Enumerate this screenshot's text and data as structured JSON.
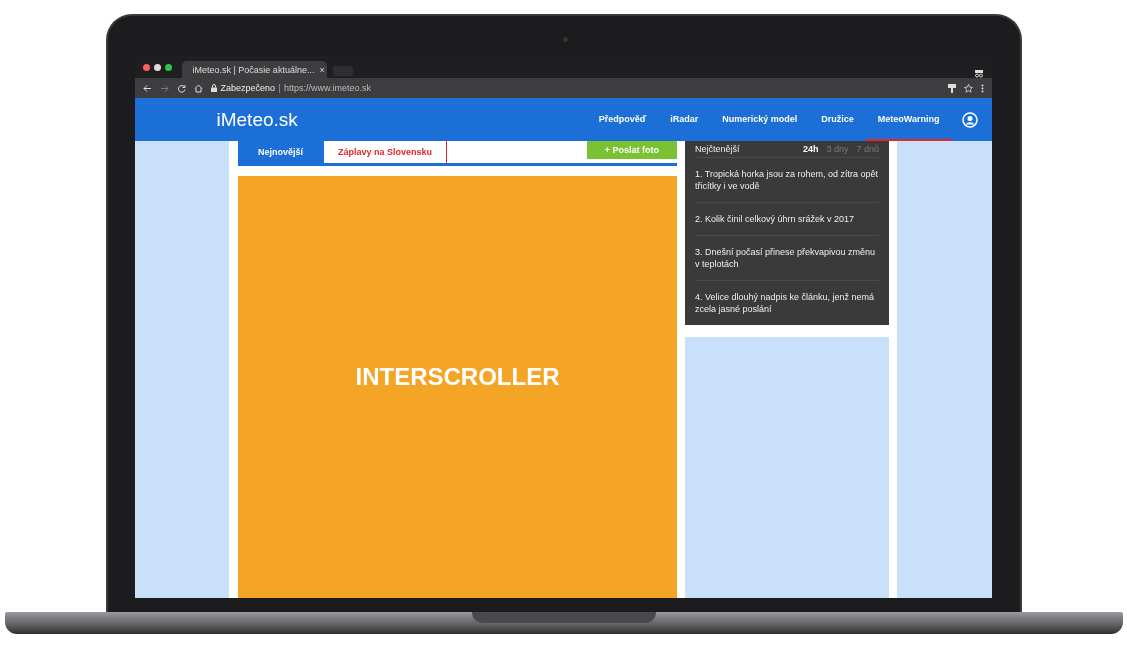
{
  "browser": {
    "tab_title": "iMeteo.sk | Počasie aktuálne...",
    "close": "×",
    "security": "Zabezpečeno",
    "url": "https://www.imeteo.sk"
  },
  "header": {
    "logo": "iMeteo.sk",
    "nav": [
      {
        "label": "Předpověď",
        "selected": false
      },
      {
        "label": "iRadar",
        "selected": false
      },
      {
        "label": "Numerický model",
        "selected": false
      },
      {
        "label": "Družice",
        "selected": false
      },
      {
        "label": "MeteoWarning",
        "selected": true
      }
    ]
  },
  "news_tabs": [
    {
      "label": "Nejnovější",
      "selected": true
    },
    {
      "label": "Záplavy na Slovensku",
      "selected": false
    }
  ],
  "send_photo": "+ Poslat foto",
  "ad": {
    "label": "INTERSCROLLER"
  },
  "most_read": {
    "title": "Nejčtenější",
    "periods": [
      {
        "label": "24h",
        "selected": true
      },
      {
        "label": "3 dny",
        "selected": false
      },
      {
        "label": "7 dnů",
        "selected": false
      }
    ],
    "articles": [
      "1. Tropická horka jsou za rohem, od zítra opět třicítky i ve vodě",
      "2. Kolik činil celkový úhrn srážek v 2017",
      "3. Dnešní počasí přinese překvapivou změnu v teplotách",
      "4. Velice dlouhý nadpis ke článku, jenž nemá zcela jasné poslání"
    ]
  }
}
